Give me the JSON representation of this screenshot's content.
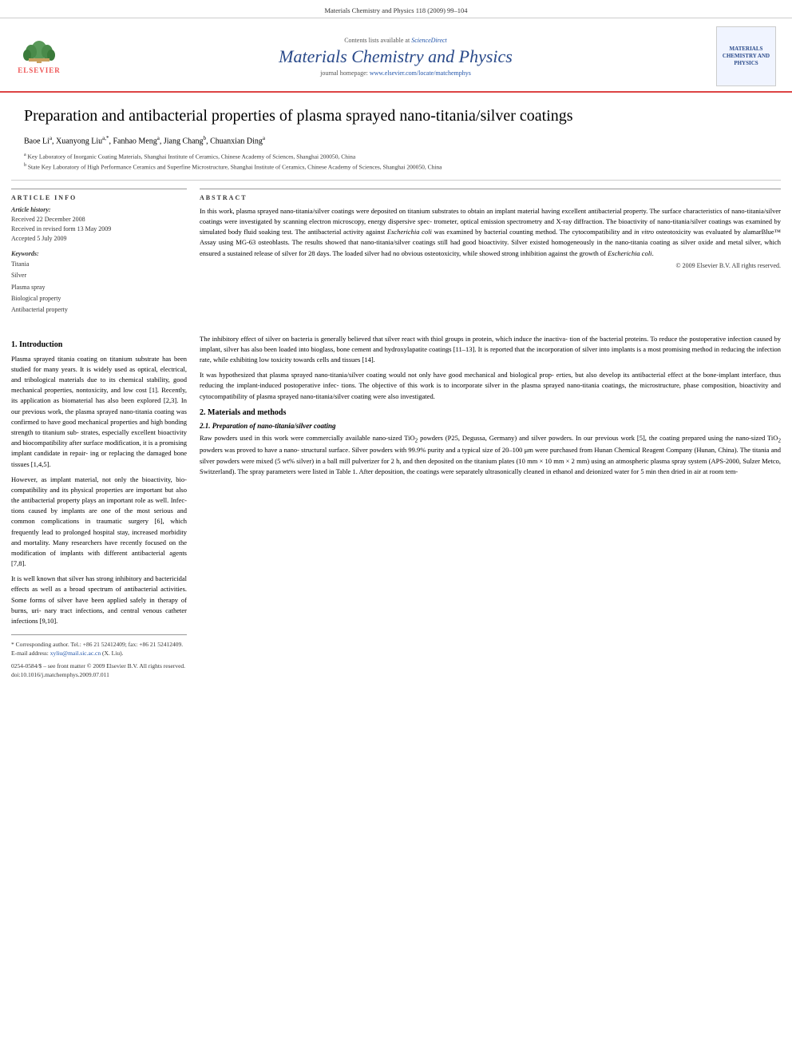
{
  "header": {
    "journal_citation": "Materials Chemistry and Physics 118 (2009) 99–104"
  },
  "banner": {
    "contents_line": "Contents lists available at",
    "sciencedirect": "ScienceDirect",
    "journal_title": "Materials Chemistry and Physics",
    "homepage_prefix": "journal homepage:",
    "homepage_url": "www.elsevier.com/locate/matchemphys",
    "elsevier_text": "ELSEVIER",
    "logo_text": "MATERIALS\nCHEMISTRY AND\nPHYSICS"
  },
  "article": {
    "title": "Preparation and antibacterial properties of plasma sprayed nano-titania/silver coatings",
    "authors": "Baoe Liᵃ, Xuanyong Liuᵃ,*, Fanhao Mengᵃ, Jiang Changᵇ, Chuanxian Dingᵃ",
    "affiliations": [
      "a Key Laboratory of Inorganic Coating Materials, Shanghai Institute of Ceramics, Chinese Academy of Sciences, Shanghai 200050, China",
      "b State Key Laboratory of High Performance Ceramics and Superfine Microstructure, Shanghai Institute of Ceramics, Chinese Academy of Sciences, Shanghai 200050, China"
    ]
  },
  "article_info": {
    "section_title": "ARTICLE INFO",
    "history_label": "Article history:",
    "received": "Received 22 December 2008",
    "revised": "Received in revised form 13 May 2009",
    "accepted": "Accepted 5 July 2009",
    "keywords_label": "Keywords:",
    "keywords": [
      "Titania",
      "Silver",
      "Plasma spray",
      "Biological property",
      "Antibacterial property"
    ]
  },
  "abstract": {
    "section_title": "ABSTRACT",
    "text": "In this work, plasma sprayed nano-titania/silver coatings were deposited on titanium substrates to obtain an implant material having excellent antibacterial property. The surface characteristics of nano-titania/silver coatings were investigated by scanning electron microscopy, energy dispersive spectrometer, optical emission spectrometry and X-ray diffraction. The bioactivity of nano-titania/silver coatings was examined by simulated body fluid soaking test. The antibacterial activity against Escherichia coli was examined by bacterial counting method. The cytocompatibility and in vitro osteotoxicity was evaluated by alamarBlue™ Assay using MG-63 osteoblasts. The results showed that nano-titania/silver coatings still had good bioactivity. Silver existed homogeneously in the nano-titania coating as silver oxide and metal silver, which ensured a sustained release of silver for 28 days. The loaded silver had no obvious osteotoxicity, while showed strong inhibition against the growth of Escherichia coli.",
    "copyright": "© 2009 Elsevier B.V. All rights reserved."
  },
  "introduction": {
    "number": "1.",
    "title": "Introduction",
    "paragraphs": [
      "Plasma sprayed titania coating on titanium substrate has been studied for many years. It is widely used as optical, electrical, and tribological materials due to its chemical stability, good mechanical properties, nontoxicity, and low cost [1]. Recently, its application as biomaterial has also been explored [2,3]. In our previous work, the plasma sprayed nano-titania coating was confirmed to have good mechanical properties and high bonding strength to titanium substrates, especially excellent bioactivity and biocompatibility after surface modification, it is a promising implant candidate in repairing or replacing the damaged bone tissues [1,4,5].",
      "However, as implant material, not only the bioactivity, biocompatibility and its physical properties are important but also the antibacterial property plays an important role as well. Infections caused by implants are one of the most serious and common complications in traumatic surgery [6], which frequently lead to prolonged hospital stay, increased morbidity and mortality. Many researchers have recently focused on the modification of implants with different antibacterial agents [7,8].",
      "It is well known that silver has strong inhibitory and bactericidal effects as well as a broad spectrum of antibacterial activities. Some forms of silver have been applied safely in therapy of burns, urinary tract infections, and central venous catheter infections [9,10]."
    ]
  },
  "right_column_intro": {
    "paragraphs": [
      "The inhibitory effect of silver on bacteria is generally believed that silver react with thiol groups in protein, which induce the inactivation of the bacterial proteins. To reduce the postoperative infection caused by implant, silver has also been loaded into bioglass, bone cement and hydroxylapatite coatings [11–13]. It is reported that the incorporation of silver into implants is a most promising method in reducing the infection rate, while exhibiting low toxicity towards cells and tissues [14].",
      "It was hypothesized that plasma sprayed nano-titania/silver coating would not only have good mechanical and biological properties, but also develop its antibacterial effect at the bone-implant interface, thus reducing the implant-induced postoperative infections. The objective of this work is to incorporate silver in the plasma sprayed nano-titania coatings, the microstructure, phase composition, bioactivity and cytocompatibility of plasma sprayed nano-titania/silver coating were also investigated."
    ]
  },
  "methods": {
    "number": "2.",
    "title": "Materials and methods",
    "subsection_number": "2.1.",
    "subsection_title": "Preparation of nano-titania/silver coating",
    "text": "Raw powders used in this work were commercially available nano-sized TiO2 powders (P25, Degussa, Germany) and silver powders. In our previous work [5], the coating prepared using the nano-sized TiO2 powders was proved to have a nanostructural surface. Silver powders with 99.9% purity and a typical size of 20–100 μm were purchased from Hunan Chemical Reagent Company (Hunan, China). The titania and silver powders were mixed (5 wt% silver) in a ball mill pulverizer for 2 h, and then deposited on the titanium plates (10 mm × 10 mm × 2 mm) using an atmospheric plasma spray system (APS-2000, Sulzer Metco, Switzerland). The spray parameters were listed in Table 1. After deposition, the coatings were separately ultrasonically cleaned in ethanol and deionized water for 5 min then dried in air at room tem-"
  },
  "footnotes": {
    "corresponding_label": "* Corresponding author. Tel.: +86 21 52412409; fax: +86 21 52412409.",
    "email_label": "E-mail address:",
    "email": "xyliu@mail.sic.ac.cn",
    "email_suffix": "(X. Liu).",
    "issn": "0254-0584/$ – see front matter © 2009 Elsevier B.V. All rights reserved.",
    "doi": "doi:10.1016/j.matchemphys.2009.07.011"
  }
}
